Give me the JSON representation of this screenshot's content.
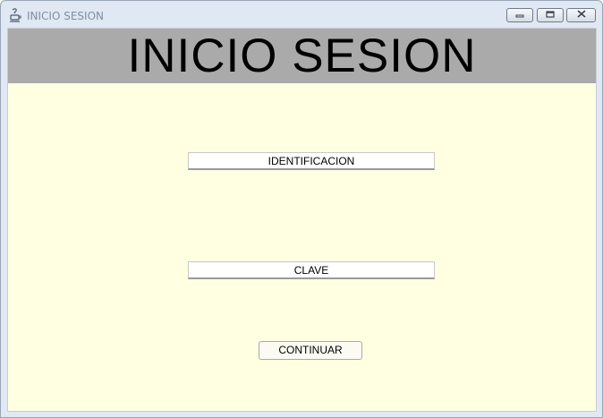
{
  "window": {
    "title": "INICIO SESION",
    "controls": {
      "minimize": "minimize-icon",
      "maximize": "maximize-icon",
      "close": "close-icon"
    }
  },
  "header": {
    "title": "INICIO SESION"
  },
  "form": {
    "identificacion_label": "IDENTIFICACION",
    "clave_label": "CLAVE",
    "continuar_label": "CONTINUAR"
  },
  "colors": {
    "header_bg": "#aaaaaa",
    "client_bg": "#ffffe1",
    "window_frame": "#dfe8f3"
  }
}
